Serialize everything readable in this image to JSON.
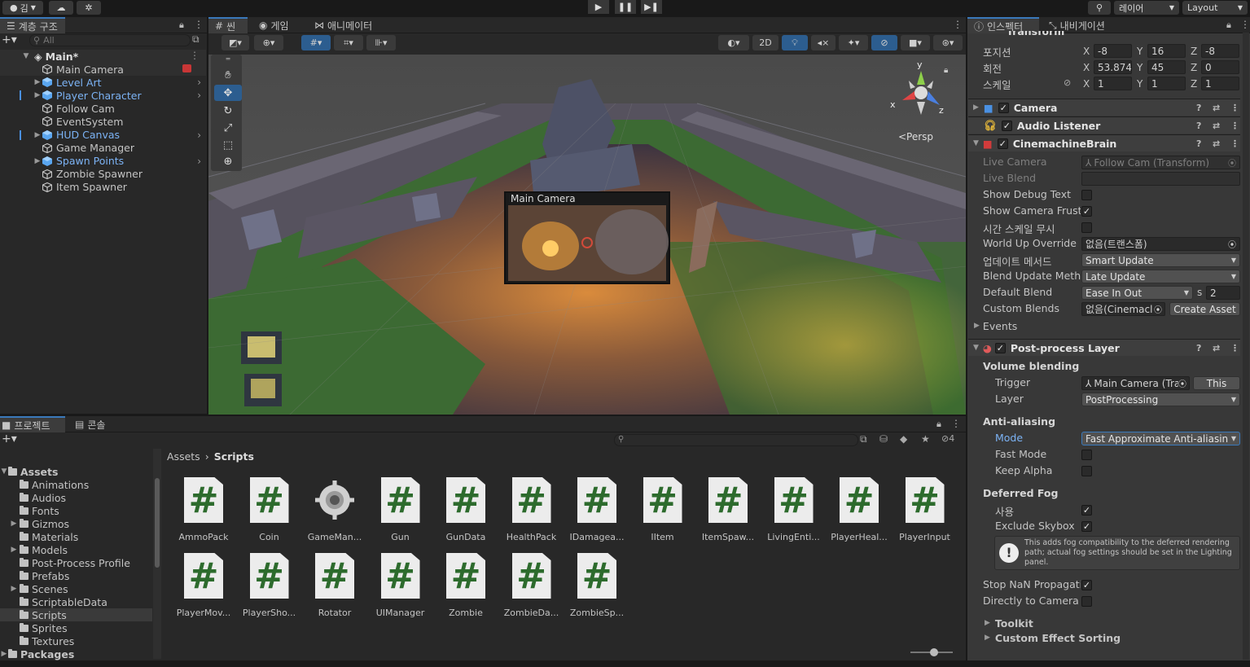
{
  "toolbar": {
    "account_label": "김",
    "layers_label": "레이어",
    "layout_label": "Layout"
  },
  "hierarchy": {
    "tab": "계층 구조",
    "search_placeholder": "All",
    "scene_name": "Main*",
    "items": [
      {
        "label": "Main Camera",
        "prefab": false,
        "expandable": false
      },
      {
        "label": "Level Art",
        "prefab": true,
        "expandable": true
      },
      {
        "label": "Player Character",
        "prefab": true,
        "expandable": true
      },
      {
        "label": "Follow Cam",
        "prefab": false,
        "expandable": false
      },
      {
        "label": "EventSystem",
        "prefab": false,
        "expandable": false
      },
      {
        "label": "HUD Canvas",
        "prefab": true,
        "expandable": true
      },
      {
        "label": "Game Manager",
        "prefab": false,
        "expandable": false
      },
      {
        "label": "Spawn Points",
        "prefab": true,
        "expandable": true
      },
      {
        "label": "Zombie Spawner",
        "prefab": false,
        "expandable": false
      },
      {
        "label": "Item Spawner",
        "prefab": false,
        "expandable": false
      }
    ]
  },
  "scene_view": {
    "tabs": [
      "씬",
      "게임",
      "애니메이터"
    ],
    "mode_2d": "2D",
    "persp_label": "<Persp",
    "camera_preview_title": "Main Camera",
    "gizmo_axes": {
      "y": "y",
      "x": "x",
      "z": "z"
    }
  },
  "inspector": {
    "tabs": [
      "인스펙터",
      "내비게이션"
    ],
    "transform_title": "Transform",
    "position": {
      "label": "포지션",
      "x": "-8",
      "y": "16",
      "z": "-8"
    },
    "rotation": {
      "label": "회전",
      "x": "53.874",
      "y": "45",
      "z": "0"
    },
    "scale": {
      "label": "스케일",
      "x": "1",
      "y": "1",
      "z": "1"
    },
    "axis_labels": {
      "x": "X",
      "y": "Y",
      "z": "Z"
    },
    "components": {
      "camera": "Camera",
      "audio_listener": "Audio Listener",
      "cinemachine_brain": "CinemachineBrain",
      "post_process": "Post-process Layer"
    },
    "brain": {
      "live_camera_label": "Live Camera",
      "live_camera_value": "Follow Cam (Transform)",
      "live_blend_label": "Live Blend",
      "show_debug_text_label": "Show Debug Text",
      "show_camera_frustum_label": "Show Camera Frust",
      "ignore_timescale_label": "시간 스케일 무시",
      "world_up_label": "World Up Override",
      "world_up_value": "없음(트랜스폼)",
      "update_method_label": "업데이트 메서드",
      "update_method_value": "Smart Update",
      "blend_update_label": "Blend Update Metho",
      "blend_update_value": "Late Update",
      "default_blend_label": "Default Blend",
      "default_blend_value": "Ease In Out",
      "default_blend_s": "s",
      "default_blend_time": "2",
      "custom_blends_label": "Custom Blends",
      "custom_blends_value": "없음(Cinemacl",
      "create_asset": "Create Asset",
      "events_label": "Events"
    },
    "post": {
      "volume_blending": "Volume blending",
      "trigger_label": "Trigger",
      "trigger_value": "Main Camera (Tra",
      "this_button": "This",
      "layer_label": "Layer",
      "layer_value": "PostProcessing",
      "anti_aliasing": "Anti-aliasing",
      "mode_label": "Mode",
      "mode_value": "Fast Approximate Anti-aliasin",
      "fast_mode_label": "Fast Mode",
      "keep_alpha_label": "Keep Alpha",
      "deferred_fog": "Deferred Fog",
      "use_label": "사용",
      "exclude_skybox_label": "Exclude Skybox",
      "help_text": "This adds fog compatibility to the deferred rendering path; actual fog settings should be set in the Lighting panel.",
      "stop_nan_label": "Stop NaN Propagatic",
      "direct_to_camera_label": "Directly to Camera T",
      "toolkit": "Toolkit",
      "custom_effect_sorting": "Custom Effect Sorting"
    }
  },
  "project": {
    "tabs": [
      "프로젝트",
      "콘솔"
    ],
    "hidden_count": "4",
    "breadcrumb": [
      "Assets",
      "Scripts"
    ],
    "assets_root": "Assets",
    "folders": [
      "Animations",
      "Audios",
      "Fonts",
      "Gizmos",
      "Materials",
      "Models",
      "Post-Process Profile",
      "Prefabs",
      "Scenes",
      "ScriptableData",
      "Scripts",
      "Sprites",
      "Textures"
    ],
    "packages": "Packages",
    "files": [
      "AmmoPack",
      "Coin",
      "GameMan...",
      "Gun",
      "GunData",
      "HealthPack",
      "IDamagea...",
      "IItem",
      "ItemSpaw...",
      "LivingEnti...",
      "PlayerHeal...",
      "PlayerInput",
      "PlayerMov...",
      "PlayerSho...",
      "Rotator",
      "UIManager",
      "Zombie",
      "ZombieDa...",
      "ZombieSp..."
    ]
  }
}
